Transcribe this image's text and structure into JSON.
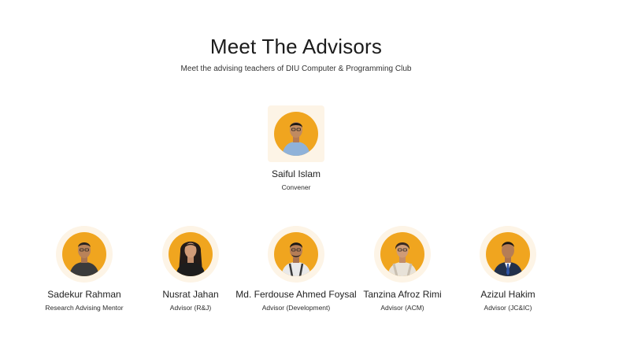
{
  "header": {
    "title": "Meet The Advisors",
    "subtitle": "Meet the advising teachers of DIU Computer & Programming Club"
  },
  "convener": {
    "name": "Saiful Islam",
    "role": "Convener",
    "avatar_icon": "person-portrait-icon",
    "shirt_color": "#8fb2d9"
  },
  "advisors": [
    {
      "name": "Sadekur Rahman",
      "role": "Research Advising Mentor",
      "avatar_icon": "person-portrait-icon",
      "shirt_color": "#3b3b3b"
    },
    {
      "name": "Nusrat Jahan",
      "role": "Advisor (R&J)",
      "avatar_icon": "person-portrait-icon",
      "shirt_color": "#1d1d1d"
    },
    {
      "name": "Md. Ferdouse Ahmed Foysal",
      "role": "Advisor (Development)",
      "avatar_icon": "person-portrait-icon",
      "shirt_color": "#e9e9e9"
    },
    {
      "name": "Tanzina Afroz Rimi",
      "role": "Advisor (ACM)",
      "avatar_icon": "person-portrait-icon",
      "shirt_color": "#e8e2d8"
    },
    {
      "name": "Azizul Hakim",
      "role": "Advisor (JC&IC)",
      "avatar_icon": "person-portrait-icon",
      "shirt_color": "#22304a"
    }
  ],
  "colors": {
    "avatar_background": "#f0a51f",
    "avatar_ring": "#fdf4e6"
  }
}
